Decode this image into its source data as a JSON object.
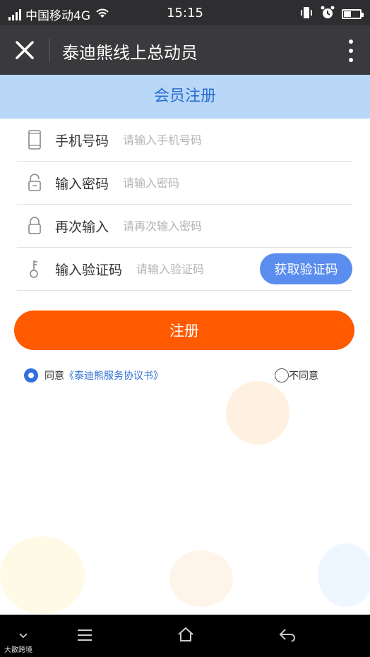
{
  "status_bar": {
    "carrier": "中国移动4G",
    "time": "15:15",
    "battery_level": 0.45
  },
  "header": {
    "title": "泰迪熊线上总动员"
  },
  "section": {
    "title": "会员注册"
  },
  "form": {
    "phone": {
      "label": "手机号码",
      "placeholder": "请输入手机号码"
    },
    "password": {
      "label": "输入密码",
      "placeholder": "请输入密码"
    },
    "confirm": {
      "label": "再次输入",
      "placeholder": "请再次输入密码"
    },
    "code": {
      "label": "输入验证码",
      "placeholder": "请输入验证码",
      "button": "获取验证码"
    }
  },
  "submit_label": "注册",
  "agreement": {
    "agree_label": "同意",
    "link_text": "《泰迪熊服务协议书》",
    "disagree_label": "不同意",
    "selected": "agree"
  },
  "watermark": "大散跨境",
  "colors": {
    "accent": "#2b6ed1",
    "submit": "#ff5a00",
    "header_band": "#b9d8f8",
    "code_button": "#5b8def"
  }
}
